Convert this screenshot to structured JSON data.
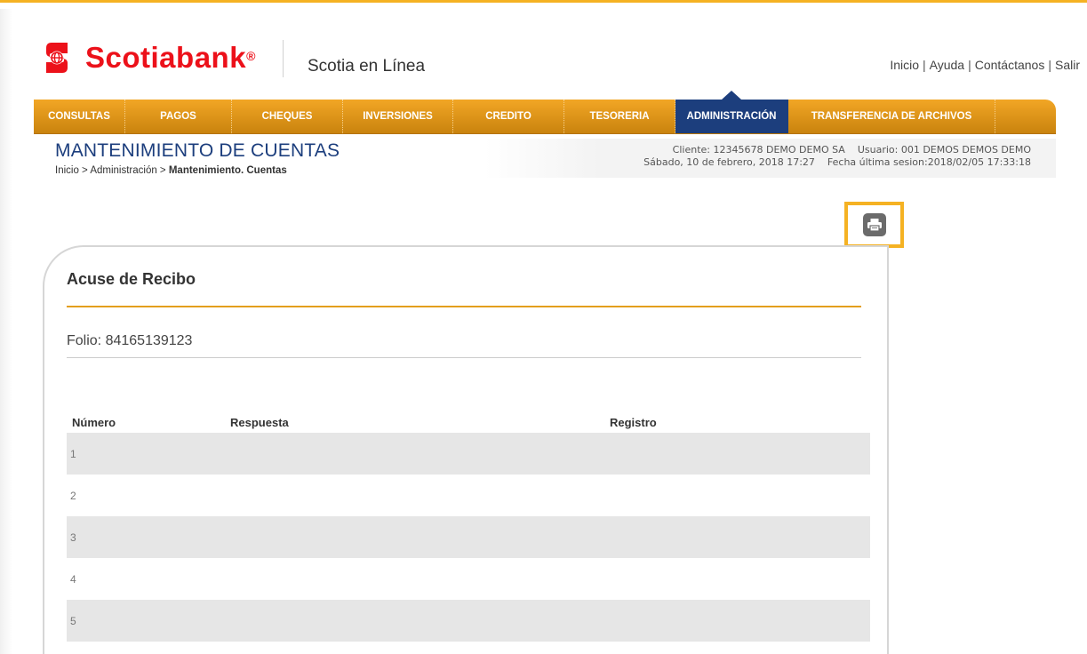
{
  "brand": {
    "name": "Scotiabank",
    "registered_mark": "®",
    "app_name": "Scotia en Línea",
    "colors": {
      "brand_red": "#ec111a",
      "nav_orange": "#e69a1a",
      "nav_active": "#1c3e7d",
      "highlight": "#f5b223"
    }
  },
  "top_links": [
    "Inicio",
    "Ayuda",
    "Contáctanos",
    "Salir"
  ],
  "top_links_separator": "|",
  "nav": {
    "items": [
      {
        "label": "CONSULTAS",
        "active": false
      },
      {
        "label": "PAGOS",
        "active": false
      },
      {
        "label": "CHEQUES",
        "active": false
      },
      {
        "label": "INVERSIONES",
        "active": false
      },
      {
        "label": "CREDITO",
        "active": false
      },
      {
        "label": "TESORERIA",
        "active": false
      },
      {
        "label": "ADMINISTRACIÓN",
        "active": true
      },
      {
        "label": "TRANSFERENCIA DE ARCHIVOS",
        "active": false
      }
    ]
  },
  "page": {
    "title": "MANTENIMIENTO DE CUENTAS",
    "breadcrumb": {
      "path": "Inicio > Administración > ",
      "current": "Mantenimiento. Cuentas"
    }
  },
  "session": {
    "client": "Cliente: 12345678 DEMO DEMO SA",
    "user": "Usuario: 001 DEMOS DEMOS DEMO",
    "date": "Sábado, 10 de febrero, 2018 17:27",
    "last_session": "Fecha última sesion:2018/02/05 17:33:18"
  },
  "actions": {
    "print_icon": "printer-icon"
  },
  "receipt": {
    "title": "Acuse de Recibo",
    "folio": "Folio: 84165139123",
    "columns": [
      "Número",
      "Respuesta",
      "Registro"
    ],
    "rows": [
      "1",
      "2",
      "3",
      "4",
      "5"
    ]
  }
}
